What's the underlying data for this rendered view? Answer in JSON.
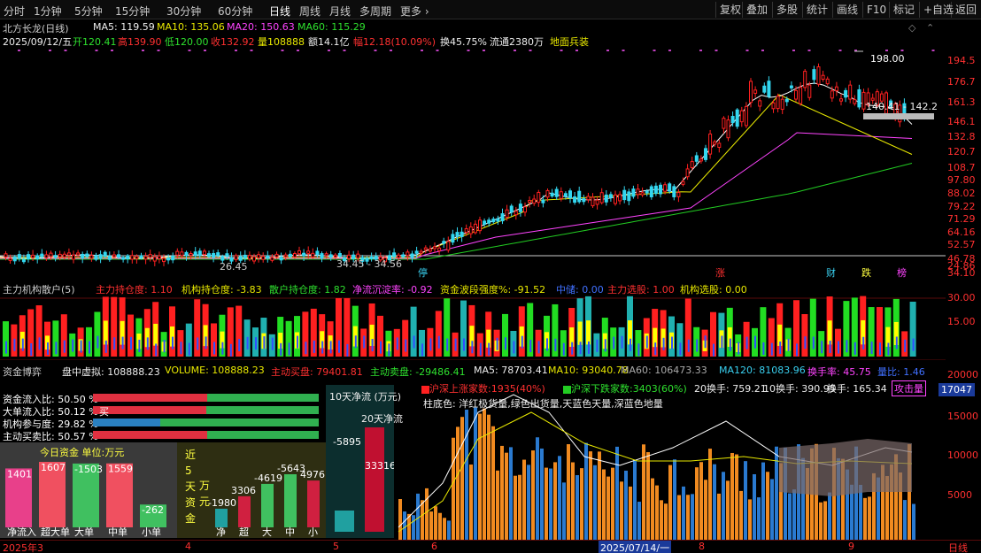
{
  "toolbar": {
    "periods": [
      "分时",
      "1分钟",
      "5分钟",
      "15分钟",
      "30分钟",
      "60分钟",
      "日线",
      "周线",
      "月线",
      "多周期",
      "更多 ›"
    ],
    "right": [
      "复权",
      "叠加",
      "多股",
      "统计",
      "画线",
      "F10",
      "标记",
      "+自选",
      "返回"
    ]
  },
  "stock": {
    "title": "北方长龙(日线)",
    "ma5": "MA5: 119.59",
    "ma10": "MA10: 135.06",
    "ma20": "MA20: 150.63",
    "ma60": "MA60: 115.29",
    "date": "2025/09/12/五",
    "open": "开120.41",
    "high": "高139.90",
    "low": "低120.00",
    "close": "收132.92",
    "vol": "量108888",
    "amt": "额14.1亿",
    "amp": "幅12.18(10.09%)",
    "turn": "换45.75%",
    "float": "流通2380万",
    "tag": "地面兵装",
    "price_axis": [
      "194.5",
      "176.7",
      "161.3",
      "146.1",
      "132.8",
      "120.7",
      "108.7",
      "97.80",
      "88.02",
      "79.22",
      "71.29",
      "64.16",
      "52.57",
      "46.78",
      "34.10",
      "24.86"
    ],
    "marks": {
      "peak": "198.00",
      "low": "26.45",
      "range": "34.45 - 34.56",
      "band": "140.41 - 142.2",
      "ting": "停",
      "zhang": "涨",
      "cai": "财",
      "die": "跌",
      "bang": "榜"
    }
  },
  "panel2": {
    "title": "主力机构散户(5)",
    "zlcc": "主力持仓度: 1.10",
    "jgcc": "机构持仓度: -3.83",
    "shcc": "散户持仓度: 1.82",
    "jlcs": "净流沉淀率: -0.92",
    "zjbd": "资金波段强度%: -91.52",
    "zhongcou": "中储: 0.00",
    "zlxg": "主力选股: 1.00",
    "jgxg": "机构选股: 0.00",
    "axis": [
      "30.00",
      "15.00"
    ]
  },
  "panel3": {
    "title": "资金博弈",
    "sub": "盘中虚拟: 108888.23",
    "volume": "VOLUME: 108888.23",
    "buy": "主动买盘: 79401.81",
    "sell": "主动卖盘: -29486.41",
    "ma5": "MA5: 78703.41",
    "ma10": "MA10: 93040.78",
    "ma60": "MA60: 106473.33",
    "ma120": "MA120: 81083.96",
    "hsl": "换手率: 45.75",
    "lb": "量比: 1.46",
    "axis": [
      "20000",
      "15000",
      "10000",
      "5000"
    ],
    "badge": "17047",
    "legend1": "沪深上涨家数:1935(40%)",
    "legend2": "沪深下跌家数:3403(60%)",
    "h20": "20换手: 759.21",
    "h10": "10换手: 390.95",
    "hs": "换手: 165.34",
    "gjl": "攻击量",
    "note": "柱底色: 洋红极货量,绿色出货量,天蓝色天量,深蓝色地量"
  },
  "fund": {
    "rows": [
      {
        "label": "资金流入比: 50.50 %",
        "frac": 0.505
      },
      {
        "label": "大单流入比: 50.12 %",
        "frac": 0.501,
        "extra": "买"
      },
      {
        "label": "机构参与度: 29.82 %",
        "frac": 0.298
      },
      {
        "label": "主动买卖比: 50.57 %",
        "frac": 0.506
      }
    ],
    "today_title": "今日资金 单位:万元",
    "today": [
      {
        "name": "净流入",
        "val": "1401",
        "v": 1401,
        "color": "#e8408a"
      },
      {
        "name": "超大单",
        "val": "1607",
        "v": 1607,
        "color": "#f05060"
      },
      {
        "name": "大单",
        "val": "-1503",
        "v": -1503,
        "color": "#40c060"
      },
      {
        "name": "中单",
        "val": "1559",
        "v": 1559,
        "color": "#f05060"
      },
      {
        "name": "小单",
        "val": "-262",
        "v": -262,
        "color": "#40c060"
      }
    ],
    "five_title": "近5天资金",
    "five_unit": "万元",
    "five": [
      {
        "name": "净",
        "val": "-1980",
        "v": -1980,
        "color": "#20a0a0"
      },
      {
        "name": "超",
        "val": "3306",
        "v": 3306,
        "color": "#d02040"
      },
      {
        "name": "大",
        "val": "-4619",
        "v": -4619,
        "color": "#40c060"
      },
      {
        "name": "中",
        "val": "-5643",
        "v": -5643,
        "color": "#40c060"
      },
      {
        "name": "小",
        "val": "4976",
        "v": 4976,
        "color": "#d02040"
      }
    ],
    "ten_title": "10天净流 (万元)",
    "ten_val": "-5895",
    "twenty_title": "20天净流",
    "twenty_val": "33316"
  },
  "xaxis": {
    "labels": [
      "2025年3",
      "4",
      "5",
      "6",
      "2025/07/14/一",
      "8",
      "9"
    ],
    "end": "日线"
  },
  "colors": {
    "up": "#ff2020",
    "down": "#33d7f0",
    "ma5": "#ffffff",
    "ma10": "#e8e800",
    "ma20": "#ff44ff",
    "ma60": "#22cc22"
  }
}
